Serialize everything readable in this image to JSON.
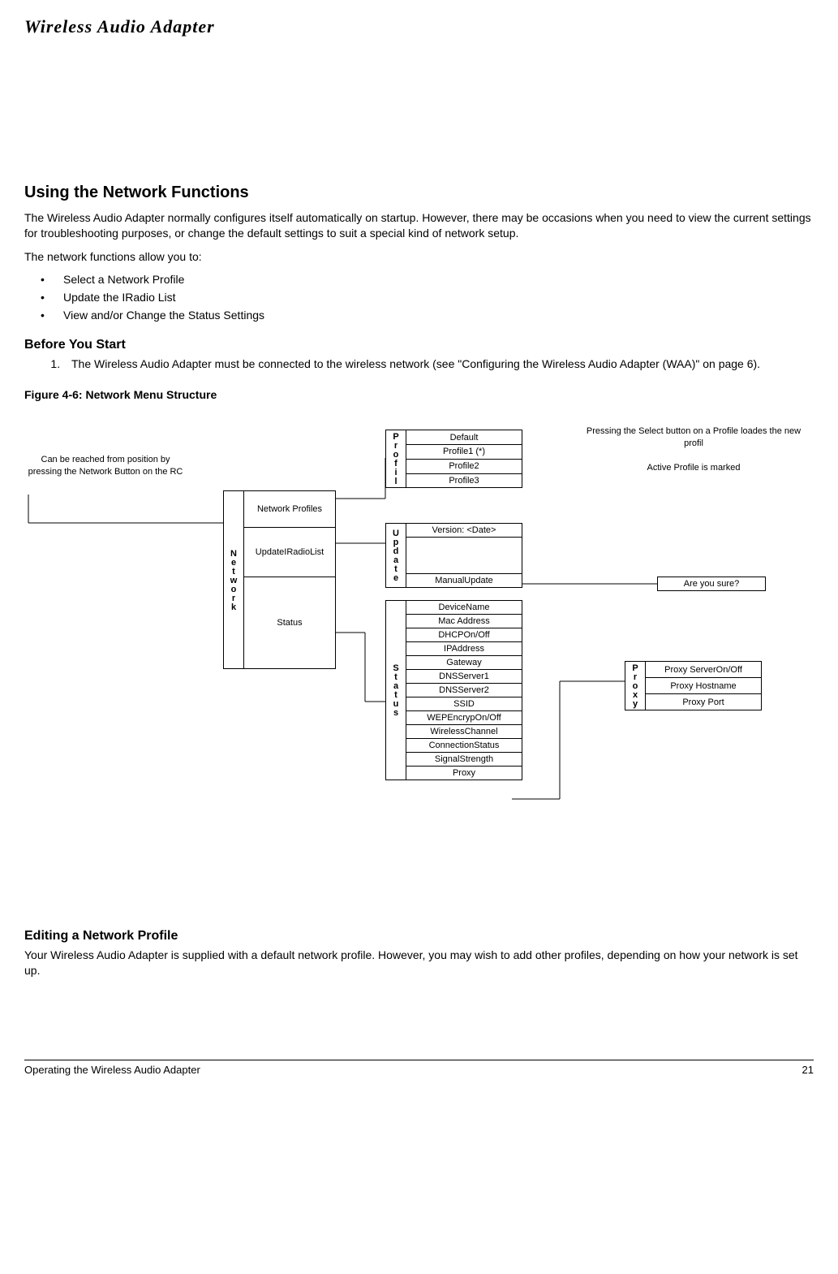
{
  "header": {
    "title": "Wireless Audio Adapter"
  },
  "section1": {
    "title": "Using the Network Functions",
    "p1": "The Wireless Audio Adapter normally configures itself automatically on startup. However, there may be occasions when you need to view the current settings for troubleshooting purposes, or change the default settings to suit a special kind of network setup.",
    "p2": "The network functions allow you to:",
    "bullets": {
      "b1": "Select a Network Profile",
      "b2": "Update the IRadio List",
      "b3": "View and/or Change the Status Settings"
    }
  },
  "before": {
    "title": "Before You Start",
    "item1": "The Wireless Audio Adapter must be connected to the wireless network (see  \"Configuring the Wireless Audio Adapter (WAA)\" on page 6)."
  },
  "figure": {
    "title": "Figure 4-6: Network Menu Structure"
  },
  "diagram": {
    "note_left": "Can be reached from position by pressing the Network Button on the RC",
    "note_right_top": "Pressing the Select button on a Profile loades the new profil",
    "note_right_mid": "Active Profile is marked",
    "network_label": "Network",
    "network_items": {
      "i1": "Network Profiles",
      "i2": "UpdateIRadioList",
      "i3": "Status"
    },
    "profile_label": "Profil",
    "profile_items": {
      "p1": "Default",
      "p2": "Profile1 (*)",
      "p3": "Profile2",
      "p4": "Profile3"
    },
    "update_label": "Update",
    "update_items": {
      "u1": "Version: <Date>",
      "u2": "ManualUpdate"
    },
    "confirm": "Are you sure?",
    "status_label": "Status",
    "status_items": {
      "s1": "DeviceName",
      "s2": "Mac Address",
      "s3": "DHCPOn/Off",
      "s4": "IPAddress",
      "s5": "Gateway",
      "s6": "DNSServer1",
      "s7": "DNSServer2",
      "s8": "SSID",
      "s9": "WEPEncrypOn/Off",
      "s10": "WirelessChannel",
      "s11": "ConnectionStatus",
      "s12": "SignalStrength",
      "s13": "Proxy"
    },
    "proxy_label": "Proxy",
    "proxy_items": {
      "x1": "Proxy ServerOn/Off",
      "x2": "Proxy Hostname",
      "x3": "Proxy Port"
    }
  },
  "editing": {
    "title": "Editing a Network Profile",
    "p1": "Your Wireless Audio Adapter is supplied with a default network profile. However, you may wish to add other profiles, depending on how your network is set up."
  },
  "footer": {
    "left": "Operating the Wireless Audio Adapter",
    "right": "21"
  }
}
